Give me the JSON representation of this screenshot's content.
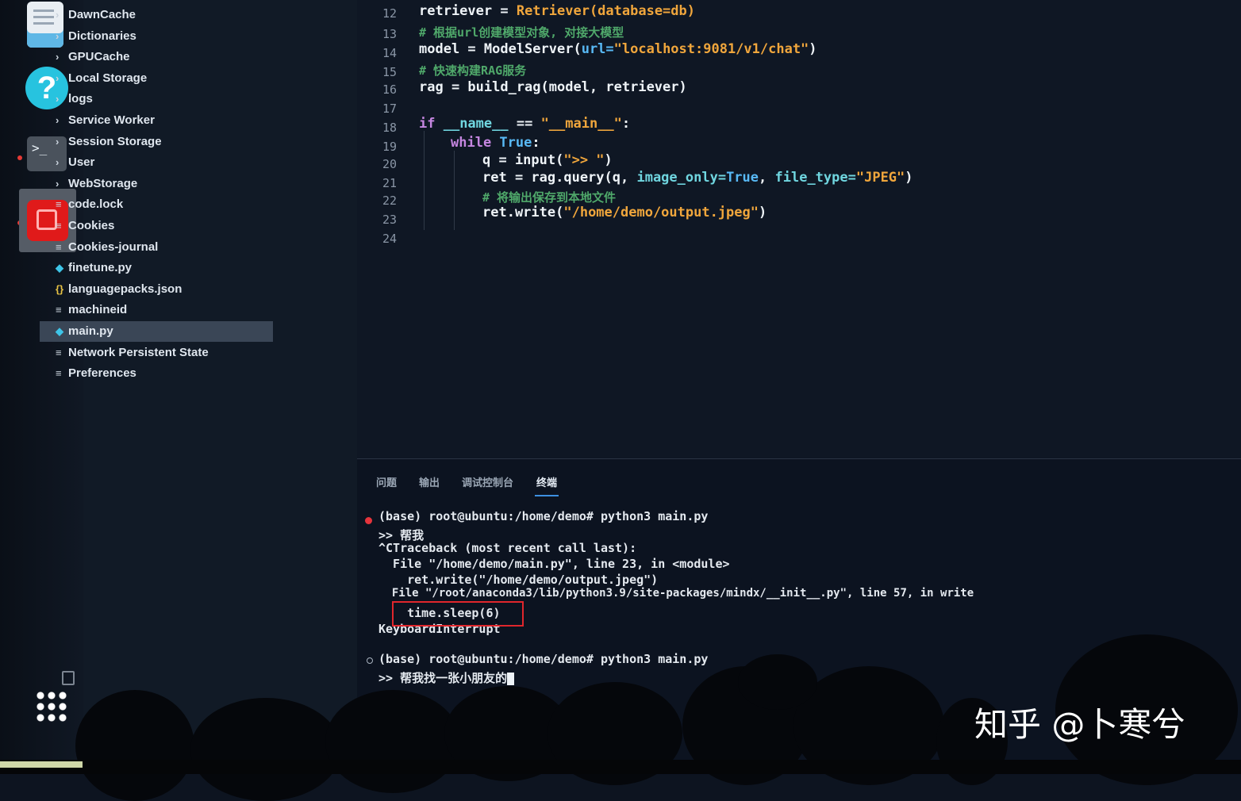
{
  "explorer": {
    "items": [
      {
        "type": "folder",
        "label": "DawnCache"
      },
      {
        "type": "folder",
        "label": "Dictionaries"
      },
      {
        "type": "folder",
        "label": "GPUCache"
      },
      {
        "type": "folder",
        "label": "Local Storage"
      },
      {
        "type": "folder",
        "label": "logs"
      },
      {
        "type": "folder",
        "label": "Service Worker"
      },
      {
        "type": "folder",
        "label": "Session Storage"
      },
      {
        "type": "folder",
        "label": "User"
      },
      {
        "type": "folder",
        "label": "WebStorage"
      },
      {
        "type": "file",
        "label": "code.lock"
      },
      {
        "type": "file",
        "label": "Cookies"
      },
      {
        "type": "file",
        "label": "Cookies-journal"
      },
      {
        "type": "python",
        "label": "finetune.py"
      },
      {
        "type": "json",
        "label": "languagepacks.json"
      },
      {
        "type": "file",
        "label": "machineid"
      },
      {
        "type": "python",
        "label": "main.py",
        "selected": true
      },
      {
        "type": "file",
        "label": "Network Persistent State"
      },
      {
        "type": "file",
        "label": "Preferences"
      }
    ]
  },
  "editor": {
    "line_numbers": [
      "12",
      "13",
      "14",
      "15",
      "16",
      "17",
      "18",
      "19",
      "20",
      "21",
      "22",
      "23",
      "24"
    ],
    "lines": {
      "l12_a": "retriever = ",
      "l12_b": "Retriever(database=db)",
      "l13": "# 根据url创建模型对象, 对接大模型",
      "l14_a": "model = ModelServer(",
      "l14_b": "url=",
      "l14_c": "\"localhost:9081/v1/chat\"",
      "l14_d": ")",
      "l15": "# 快速构建RAG服务",
      "l16": "rag = build_rag(model, retriever)",
      "l18_a": "if ",
      "l18_b": "__name__",
      "l18_c": " == ",
      "l18_d": "\"__main__\"",
      "l18_e": ":",
      "l19_a": "while ",
      "l19_b": "True",
      "l19_c": ":",
      "l20_a": "q = input(",
      "l20_b": "\">> \"",
      "l20_c": ")",
      "l21_a": "ret = rag.query(q, ",
      "l21_b": "image_only=",
      "l21_c": "True",
      "l21_d": ", ",
      "l21_e": "file_type=",
      "l21_f": "\"JPEG\"",
      "l21_g": ")",
      "l22": "# 将输出保存到本地文件",
      "l23_a": "ret.write(",
      "l23_b": "\"/home/demo/output.jpeg\"",
      "l23_c": ")"
    }
  },
  "panel": {
    "tabs": [
      "问题",
      "输出",
      "调试控制台",
      "终端"
    ],
    "active_tab": "终端"
  },
  "terminal": {
    "lines": [
      "(base) root@ubuntu:/home/demo# python3 main.py",
      ">> 帮我",
      "^CTraceback (most recent call last):",
      "  File \"/home/demo/main.py\", line 23, in <module>",
      "    ret.write(\"/home/demo/output.jpeg\")",
      "  File \"/root/anaconda3/lib/python3.9/site-packages/mindx/__init__.py\", line 57, in write",
      "    time.sleep(6)",
      "KeyboardInterrupt",
      "",
      "(base) root@ubuntu:/home/demo# python3 main.py",
      ">> 帮我找一张小朋友的"
    ]
  },
  "watermark": "知乎 @卜寒兮",
  "colors": {
    "background": "#0d1420",
    "string": "#f0a63c",
    "comment": "#4fa86a",
    "keyword": "#c586e0",
    "highlight_box": "#e0262c"
  }
}
